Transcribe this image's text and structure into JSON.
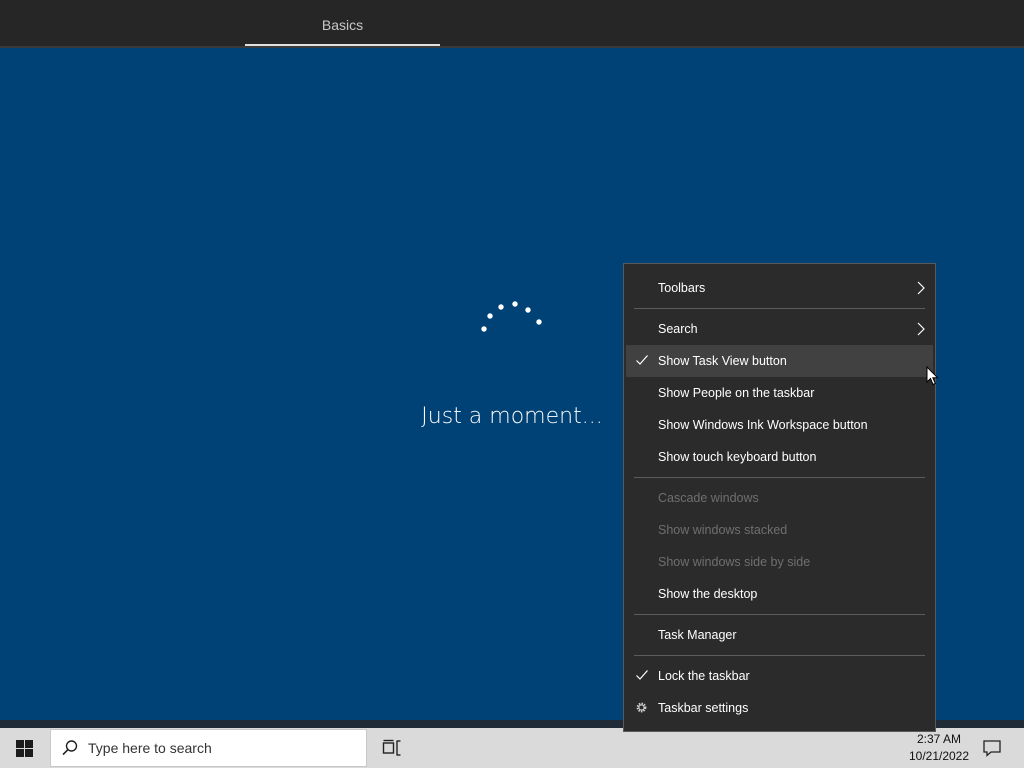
{
  "oobe": {
    "tab_label": "Basics",
    "status_text": "Just a moment..."
  },
  "context_menu": {
    "items": [
      {
        "label": "Toolbars",
        "submenu": true
      },
      {
        "label": "Search",
        "submenu": true
      },
      {
        "label": "Show Task View button",
        "checked": true,
        "highlighted": true
      },
      {
        "label": "Show People on the taskbar"
      },
      {
        "label": "Show Windows Ink Workspace button"
      },
      {
        "label": "Show touch keyboard button"
      },
      {
        "label": "Cascade windows",
        "disabled": true
      },
      {
        "label": "Show windows stacked",
        "disabled": true
      },
      {
        "label": "Show windows side by side",
        "disabled": true
      },
      {
        "label": "Show the desktop"
      },
      {
        "label": "Task Manager"
      },
      {
        "label": "Lock the taskbar",
        "checked": true
      },
      {
        "label": "Taskbar settings",
        "icon": "gear-icon"
      }
    ]
  },
  "taskbar": {
    "search_placeholder": "Type here to search",
    "time": "2:37 AM",
    "date": "10/21/2022"
  },
  "colors": {
    "oobe_background": "#004275",
    "menu_background": "#2b2b2b",
    "taskbar_background": "#dadada"
  }
}
